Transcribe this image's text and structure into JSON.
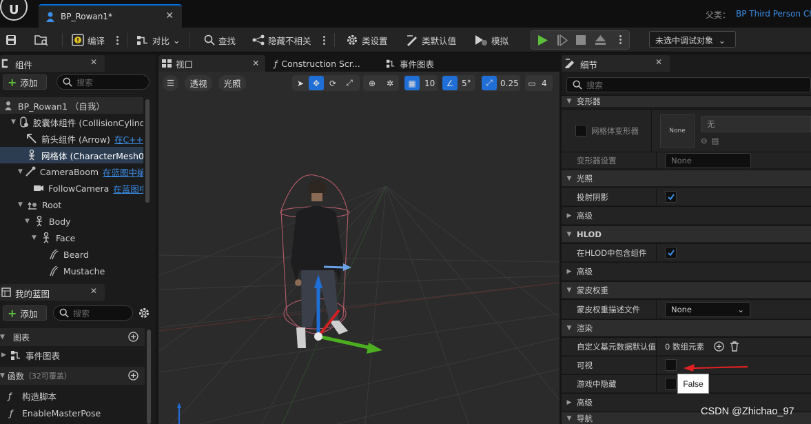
{
  "window": {
    "doc_tab": "BP_Rowan1*",
    "parent_label": "父类：",
    "parent_value": "BP Third Person Ch"
  },
  "toolbar": {
    "compile": "编译",
    "diff": "对比",
    "find": "查找",
    "hide_unrelated": "隐藏不相关",
    "class_settings": "类设置",
    "class_defaults": "类默认值",
    "simulate": "模拟",
    "debug_select": "未选中调试对象"
  },
  "components_panel": {
    "tab": "组件",
    "add": "添加",
    "search_placeholder": "搜索",
    "items": [
      {
        "label": "BP_Rowan1 （自我）",
        "link": ""
      },
      {
        "label": "胶囊体组件 (CollisionCylind",
        "link": ""
      },
      {
        "label": "箭头组件 (Arrow)",
        "link": "在C++中"
      },
      {
        "label": "网格体 (CharacterMesh0)",
        "link": ""
      },
      {
        "label": "CameraBoom",
        "link": "在蓝图中编"
      },
      {
        "label": "FollowCamera",
        "link": "在蓝图中"
      },
      {
        "label": "Root",
        "link": ""
      },
      {
        "label": "Body",
        "link": ""
      },
      {
        "label": "Face",
        "link": ""
      },
      {
        "label": "Beard",
        "link": ""
      },
      {
        "label": "Mustache",
        "link": ""
      }
    ]
  },
  "my_blueprint": {
    "tab": "我的蓝图",
    "add": "添加",
    "search_placeholder": "搜索",
    "graphs": "图表",
    "event_graph": "事件图表",
    "functions": "函数",
    "functions_count": "（32可覆盖）",
    "construction_script": "构造脚本",
    "enable_master_pose": "EnableMasterPose"
  },
  "viewport": {
    "tabs": [
      "视口",
      "Construction Scr...",
      "事件图表"
    ],
    "perspective": "透视",
    "lit": "光照",
    "grid_snap": "10",
    "rot_snap": "5°",
    "scale_snap": "0.25",
    "cam_speed": "4"
  },
  "details": {
    "tab": "细节",
    "search_placeholder": "搜索",
    "deformer_cat": "变形器",
    "mesh_deformer": "网格体变形器",
    "none_thumb": "None",
    "none_value": "无",
    "deformer_settings": "变形器设置",
    "deformer_settings_val": "None",
    "lighting_cat": "光照",
    "cast_shadow": "投射阴影",
    "advanced": "高级",
    "hlod_cat": "HLOD",
    "hlod_include": "在HLOD中包含组件",
    "skin_weights_cat": "蒙皮权重",
    "skin_weight_profile": "蒙皮权重描述文件",
    "skin_weight_val": "None",
    "rendering_cat": "渲染",
    "custom_prim_data": "自定义基元数据默认值",
    "custom_prim_val": "0 数组元素",
    "visible": "可视",
    "hidden_in_game": "游戏中隐藏",
    "nav_cat": "导航"
  },
  "tooltip": "False",
  "watermark": "CSDN @Zhichao_97",
  "colors": {
    "accent": "#1f6fd6",
    "link": "#3b8ee8",
    "play": "#5cc03a",
    "arrow": "#e02020"
  }
}
